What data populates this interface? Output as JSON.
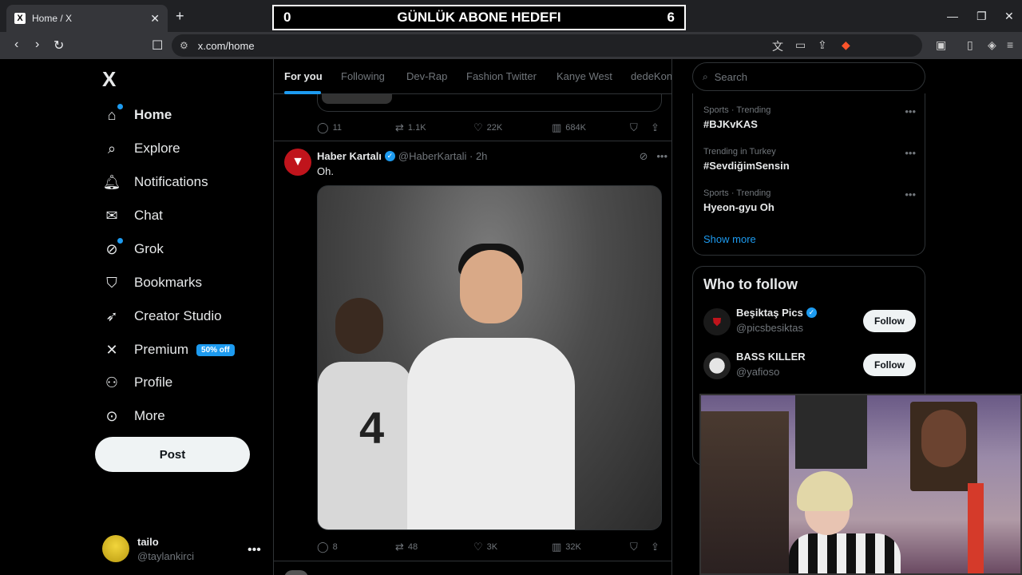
{
  "browser": {
    "tab_title": "Home / X",
    "tab_favicon": "X",
    "url": "x.com/home"
  },
  "overlay": {
    "left_value": "0",
    "title": "GÜNLÜK ABONE HEDEFI",
    "right_value": "6"
  },
  "nav": {
    "logo": "X",
    "items": [
      {
        "label": "Home",
        "icon": "home-icon"
      },
      {
        "label": "Explore",
        "icon": "search-icon"
      },
      {
        "label": "Notifications",
        "icon": "bell-icon"
      },
      {
        "label": "Chat",
        "icon": "mail-icon"
      },
      {
        "label": "Grok",
        "icon": "grok-icon"
      },
      {
        "label": "Bookmarks",
        "icon": "bookmark-icon"
      },
      {
        "label": "Creator Studio",
        "icon": "rocket-icon"
      },
      {
        "label": "Premium",
        "icon": "x-icon"
      },
      {
        "label": "Profile",
        "icon": "person-icon"
      },
      {
        "label": "More",
        "icon": "more-circle-icon"
      }
    ],
    "premium_badge": "50% off",
    "post_label": "Post",
    "account": {
      "name": "tailo",
      "handle": "@taylankirci"
    }
  },
  "feed": {
    "tabs": [
      "For you",
      "Following",
      "Dev-Rap",
      "Fashion Twitter",
      "Kanye West",
      "dedeKon"
    ],
    "prev_actions": {
      "replies": "11",
      "reposts": "1.1K",
      "likes": "22K",
      "views": "684K"
    },
    "tweet": {
      "name": "Haber Kartalı",
      "handle": "@HaberKartali",
      "time": "2h",
      "text": "Oh.",
      "replies": "8",
      "reposts": "48",
      "likes": "3K",
      "views": "32K",
      "photo_number": "4"
    }
  },
  "right": {
    "search_placeholder": "Search",
    "trends": [
      {
        "category": "Sports · Trending",
        "title": "#BJKvKAS"
      },
      {
        "category": "Trending in Turkey",
        "title": "#SevdiğimSensin"
      },
      {
        "category": "Sports · Trending",
        "title": "Hyeon-gyu Oh"
      }
    ],
    "show_more": "Show more",
    "who_to_follow": "Who to follow",
    "follows": [
      {
        "name": "Beşiktaş Pics",
        "handle": "@picsbesiktas",
        "button": "Follow"
      },
      {
        "name": "BASS KILLER",
        "handle": "@yafioso",
        "button": "Follow"
      }
    ]
  },
  "colors": {
    "accent": "#1d9bf0",
    "background": "#000000",
    "text": "#e7e9ea",
    "muted": "#71767b"
  }
}
